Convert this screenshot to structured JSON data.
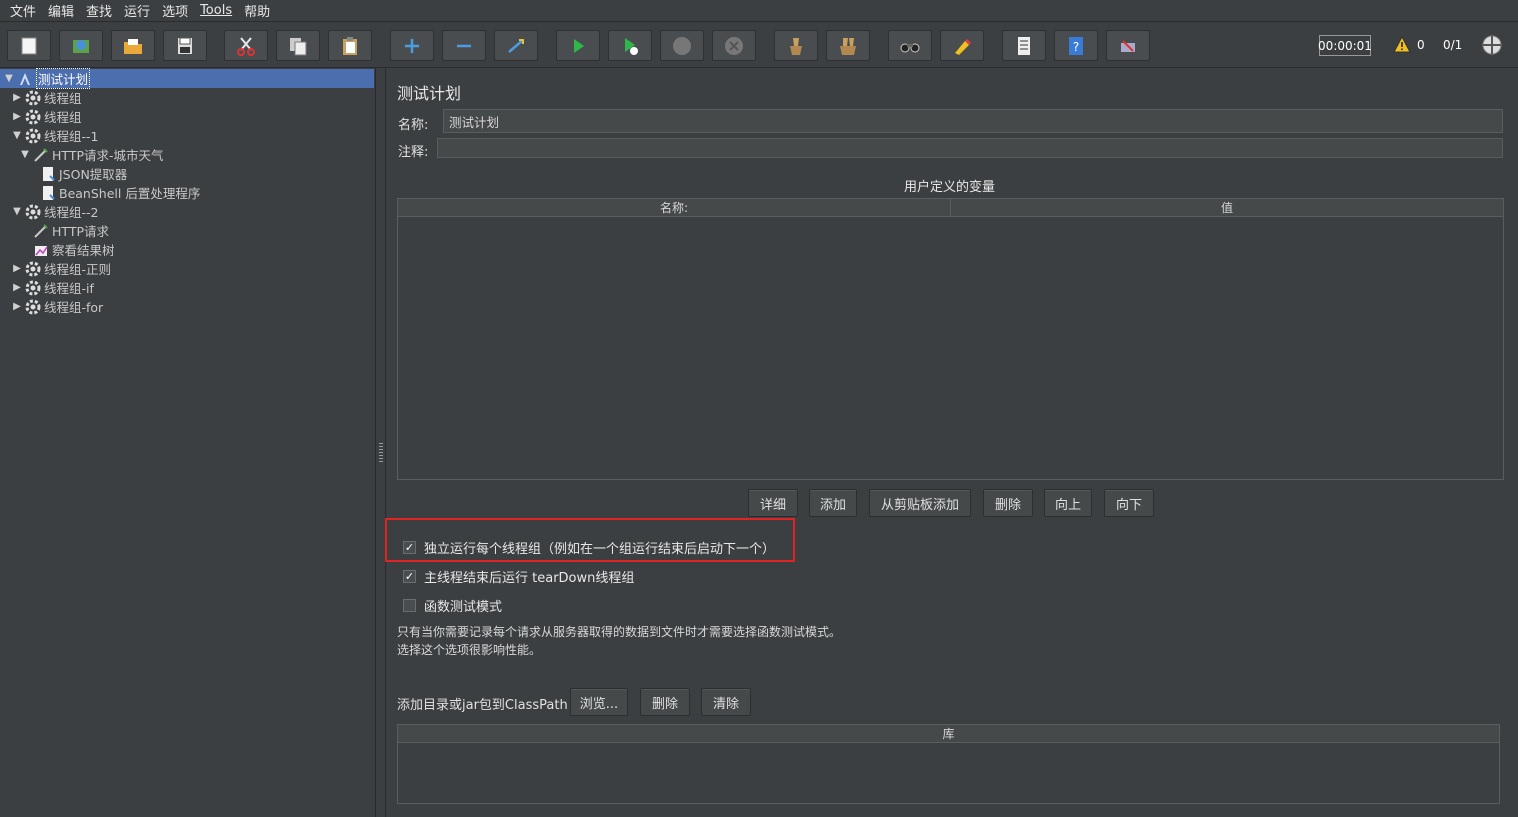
{
  "menu": {
    "items": [
      "文件",
      "编辑",
      "查找",
      "运行",
      "选项",
      "Tools",
      "帮助"
    ]
  },
  "toolbar": {
    "icons": [
      "new-icon",
      "templates-icon",
      "open-icon",
      "save-icon",
      "cut-icon",
      "copy-icon",
      "paste-icon",
      "expand-icon",
      "collapse-icon",
      "toggle-icon",
      "start-icon",
      "start-no-pause-icon",
      "stop-icon",
      "shutdown-icon",
      "clear-icon",
      "clear-all-icon",
      "search-icon",
      "reset-search-icon",
      "function-helper-icon",
      "help-icon",
      "remote-icon"
    ],
    "timer": "00:00:01",
    "warning_count": "0",
    "thread_ratio": "0/1"
  },
  "tree": {
    "items": [
      {
        "label": "测试计划",
        "level": 0,
        "expanded": true,
        "icon": "test-plan-icon",
        "selected": true
      },
      {
        "label": "线程组",
        "level": 1,
        "expanded": false,
        "icon": "thread-group-icon"
      },
      {
        "label": "线程组",
        "level": 1,
        "expanded": false,
        "icon": "thread-group-icon"
      },
      {
        "label": "线程组--1",
        "level": 1,
        "expanded": true,
        "icon": "thread-group-icon"
      },
      {
        "label": "HTTP请求-城市天气",
        "level": 2,
        "expanded": true,
        "icon": "http-sampler-icon"
      },
      {
        "label": "JSON提取器",
        "level": 3,
        "icon": "post-processor-icon"
      },
      {
        "label": "BeanShell 后置处理程序",
        "level": 3,
        "icon": "post-processor-icon"
      },
      {
        "label": "线程组--2",
        "level": 1,
        "expanded": true,
        "icon": "thread-group-icon"
      },
      {
        "label": "HTTP请求",
        "level": 2,
        "icon": "http-sampler-icon"
      },
      {
        "label": "察看结果树",
        "level": 2,
        "icon": "listener-icon"
      },
      {
        "label": "线程组-正则",
        "level": 1,
        "expanded": false,
        "icon": "thread-group-icon"
      },
      {
        "label": "线程组-if",
        "level": 1,
        "expanded": false,
        "icon": "thread-group-icon"
      },
      {
        "label": "线程组-for",
        "level": 1,
        "expanded": false,
        "icon": "thread-group-icon"
      }
    ]
  },
  "main": {
    "title": "测试计划",
    "name_label": "名称:",
    "name_value": "测试计划",
    "comment_label": "注释:",
    "comment_value": "",
    "variables_title": "用户定义的变量",
    "columns": [
      "名称:",
      "值"
    ],
    "buttons": {
      "detail": "详细",
      "add": "添加",
      "add_from_clipboard": "从剪贴板添加",
      "delete": "删除",
      "up": "向上",
      "down": "向下"
    },
    "checkboxes": {
      "serialize": {
        "label": "独立运行每个线程组（例如在一个组运行结束后启动下一个）",
        "checked": true
      },
      "teardown": {
        "label": "主线程结束后运行 tearDown线程组",
        "checked": true
      },
      "functional": {
        "label": "函数测试模式",
        "checked": false
      }
    },
    "desc_line1": "只有当你需要记录每个请求从服务器取得的数据到文件时才需要选择函数测试模式。",
    "desc_line2": "选择这个选项很影响性能。",
    "classpath_label": "添加目录或jar包到ClassPath",
    "classpath_buttons": {
      "browse": "浏览...",
      "delete": "删除",
      "clear": "清除"
    },
    "lib_column": "库"
  },
  "colors": {
    "background": "#3c3f41",
    "selection": "#4b6eaf",
    "highlight": "#e02424"
  }
}
